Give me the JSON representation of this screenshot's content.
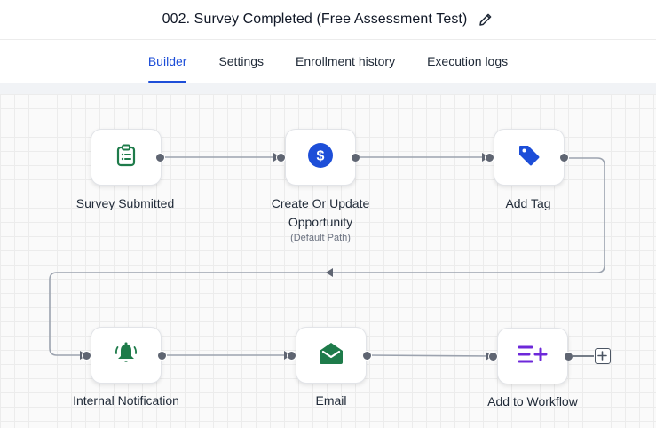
{
  "header": {
    "title": "002. Survey Completed (Free Assessment Test)",
    "edit_icon": "pencil-icon"
  },
  "tabs": [
    {
      "label": "Builder",
      "active": true
    },
    {
      "label": "Settings",
      "active": false
    },
    {
      "label": "Enrollment history",
      "active": false
    },
    {
      "label": "Execution logs",
      "active": false
    }
  ],
  "workflow": {
    "nodes": [
      {
        "label": "Survey Submitted",
        "icon": "clipboard-icon",
        "color": "#1e7b4a"
      },
      {
        "label": "Create Or Update Opportunity",
        "sublabel": "(Default Path)",
        "icon": "dollar-icon",
        "color": "#1d4ed8"
      },
      {
        "label": "Add Tag",
        "icon": "tag-icon",
        "color": "#1d4ed8"
      },
      {
        "label": "Internal Notification",
        "icon": "bell-icon",
        "color": "#1e7b4a"
      },
      {
        "label": "Email",
        "icon": "envelope-icon",
        "color": "#1e7b4a"
      },
      {
        "label": "Add to Workflow",
        "icon": "add-to-workflow-icon",
        "color": "#6d28d9"
      }
    ],
    "add_step_icon": "plus-square-icon"
  },
  "colors": {
    "accent": "#1d4ed8",
    "green": "#1e7b4a",
    "purple": "#6d28d9",
    "connector": "#9ca3af"
  }
}
